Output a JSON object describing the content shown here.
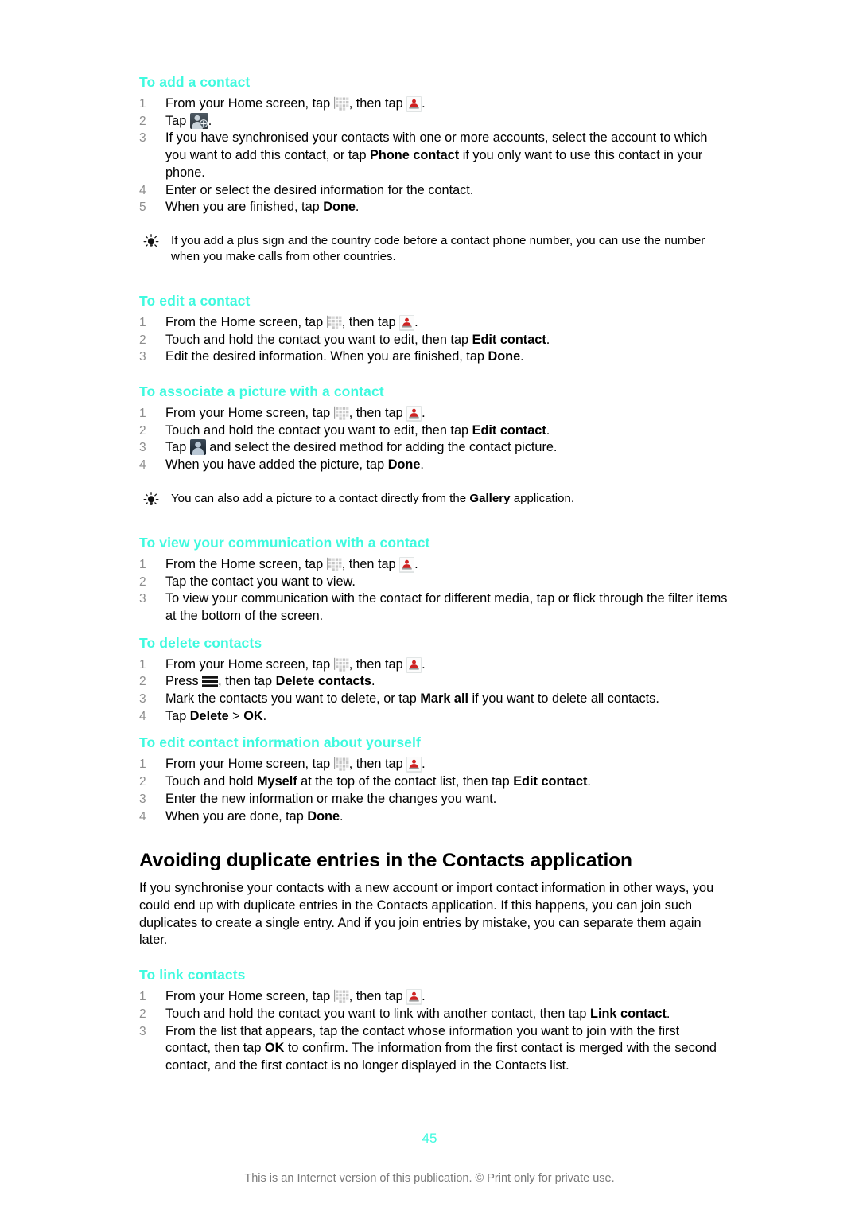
{
  "colors": {
    "heading_accent": "#3ffadf",
    "body_text": "#000000",
    "list_number": "#8d8d8d",
    "footer_text": "#7a7a7a"
  },
  "icons": {
    "app_drawer": "app-drawer-grid-icon",
    "contacts": "contacts-person-icon",
    "add_contact": "add-contact-icon",
    "avatar": "contact-picture-avatar-icon",
    "menu": "hamburger-menu-icon",
    "tip": "light-bulb-tip-icon"
  },
  "sections": [
    {
      "heading": "To add a contact",
      "steps": [
        {
          "num": "1",
          "parts": [
            {
              "t": "text",
              "v": "From your Home screen, tap "
            },
            {
              "t": "icon",
              "v": "app_drawer"
            },
            {
              "t": "text",
              "v": ", then tap "
            },
            {
              "t": "icon",
              "v": "contacts"
            },
            {
              "t": "text",
              "v": "."
            }
          ]
        },
        {
          "num": "2",
          "parts": [
            {
              "t": "text",
              "v": "Tap "
            },
            {
              "t": "icon",
              "v": "add_contact"
            },
            {
              "t": "text",
              "v": "."
            }
          ]
        },
        {
          "num": "3",
          "parts": [
            {
              "t": "text",
              "v": "If you have synchronised your contacts with one or more accounts, select the account to which you want to add this contact, or tap "
            },
            {
              "t": "bold",
              "v": "Phone contact"
            },
            {
              "t": "text",
              "v": " if you only want to use this contact in your phone."
            }
          ]
        },
        {
          "num": "4",
          "parts": [
            {
              "t": "text",
              "v": "Enter or select the desired information for the contact."
            }
          ]
        },
        {
          "num": "5",
          "parts": [
            {
              "t": "text",
              "v": "When you are finished, tap "
            },
            {
              "t": "bold",
              "v": "Done"
            },
            {
              "t": "text",
              "v": "."
            }
          ]
        }
      ]
    },
    {
      "heading": "To edit a contact",
      "steps": [
        {
          "num": "1",
          "parts": [
            {
              "t": "text",
              "v": "From the Home screen, tap "
            },
            {
              "t": "icon",
              "v": "app_drawer"
            },
            {
              "t": "text",
              "v": ", then tap "
            },
            {
              "t": "icon",
              "v": "contacts"
            },
            {
              "t": "text",
              "v": "."
            }
          ]
        },
        {
          "num": "2",
          "parts": [
            {
              "t": "text",
              "v": "Touch and hold the contact you want to edit, then tap "
            },
            {
              "t": "bold",
              "v": "Edit contact"
            },
            {
              "t": "text",
              "v": "."
            }
          ]
        },
        {
          "num": "3",
          "parts": [
            {
              "t": "text",
              "v": "Edit the desired information. When you are finished, tap "
            },
            {
              "t": "bold",
              "v": "Done"
            },
            {
              "t": "text",
              "v": "."
            }
          ]
        }
      ]
    },
    {
      "heading": "To associate a picture with a contact",
      "steps": [
        {
          "num": "1",
          "parts": [
            {
              "t": "text",
              "v": "From your Home screen, tap "
            },
            {
              "t": "icon",
              "v": "app_drawer"
            },
            {
              "t": "text",
              "v": ", then tap "
            },
            {
              "t": "icon",
              "v": "contacts"
            },
            {
              "t": "text",
              "v": "."
            }
          ]
        },
        {
          "num": "2",
          "parts": [
            {
              "t": "text",
              "v": "Touch and hold the contact you want to edit, then tap "
            },
            {
              "t": "bold",
              "v": "Edit contact"
            },
            {
              "t": "text",
              "v": "."
            }
          ]
        },
        {
          "num": "3",
          "parts": [
            {
              "t": "text",
              "v": "Tap "
            },
            {
              "t": "icon",
              "v": "avatar"
            },
            {
              "t": "text",
              "v": " and select the desired method for adding the contact picture."
            }
          ]
        },
        {
          "num": "4",
          "parts": [
            {
              "t": "text",
              "v": "When you have added the picture, tap "
            },
            {
              "t": "bold",
              "v": "Done"
            },
            {
              "t": "text",
              "v": "."
            }
          ]
        }
      ]
    },
    {
      "heading": "To view your communication with a contact",
      "steps": [
        {
          "num": "1",
          "parts": [
            {
              "t": "text",
              "v": "From the Home screen, tap "
            },
            {
              "t": "icon",
              "v": "app_drawer"
            },
            {
              "t": "text",
              "v": ", then tap "
            },
            {
              "t": "icon",
              "v": "contacts"
            },
            {
              "t": "text",
              "v": "."
            }
          ]
        },
        {
          "num": "2",
          "parts": [
            {
              "t": "text",
              "v": "Tap the contact you want to view."
            }
          ]
        },
        {
          "num": "3",
          "parts": [
            {
              "t": "text",
              "v": "To view your communication with the contact for different media, tap or flick through the filter items at the bottom of the screen."
            }
          ]
        }
      ]
    },
    {
      "heading": "To delete contacts",
      "steps": [
        {
          "num": "1",
          "parts": [
            {
              "t": "text",
              "v": "From your Home screen, tap "
            },
            {
              "t": "icon",
              "v": "app_drawer"
            },
            {
              "t": "text",
              "v": ", then tap "
            },
            {
              "t": "icon",
              "v": "contacts"
            },
            {
              "t": "text",
              "v": "."
            }
          ]
        },
        {
          "num": "2",
          "parts": [
            {
              "t": "text",
              "v": "Press "
            },
            {
              "t": "icon",
              "v": "menu"
            },
            {
              "t": "text",
              "v": ", then tap "
            },
            {
              "t": "bold",
              "v": "Delete contacts"
            },
            {
              "t": "text",
              "v": "."
            }
          ]
        },
        {
          "num": "3",
          "parts": [
            {
              "t": "text",
              "v": "Mark the contacts you want to delete, or tap "
            },
            {
              "t": "bold",
              "v": "Mark all"
            },
            {
              "t": "text",
              "v": " if you want to delete all contacts."
            }
          ]
        },
        {
          "num": "4",
          "parts": [
            {
              "t": "text",
              "v": "Tap "
            },
            {
              "t": "bold",
              "v": "Delete"
            },
            {
              "t": "text",
              "v": " > "
            },
            {
              "t": "bold",
              "v": "OK"
            },
            {
              "t": "text",
              "v": "."
            }
          ]
        }
      ]
    },
    {
      "heading": "To edit contact information about yourself",
      "steps": [
        {
          "num": "1",
          "parts": [
            {
              "t": "text",
              "v": "From your Home screen, tap "
            },
            {
              "t": "icon",
              "v": "app_drawer"
            },
            {
              "t": "text",
              "v": ", then tap "
            },
            {
              "t": "icon",
              "v": "contacts"
            },
            {
              "t": "text",
              "v": "."
            }
          ]
        },
        {
          "num": "2",
          "parts": [
            {
              "t": "text",
              "v": "Touch and hold "
            },
            {
              "t": "bold",
              "v": "Myself"
            },
            {
              "t": "text",
              "v": " at the top of the contact list, then tap "
            },
            {
              "t": "bold",
              "v": "Edit contact"
            },
            {
              "t": "text",
              "v": "."
            }
          ]
        },
        {
          "num": "3",
          "parts": [
            {
              "t": "text",
              "v": "Enter the new information or make the changes you want."
            }
          ]
        },
        {
          "num": "4",
          "parts": [
            {
              "t": "text",
              "v": "When you are done, tap "
            },
            {
              "t": "bold",
              "v": "Done"
            },
            {
              "t": "text",
              "v": "."
            }
          ]
        }
      ]
    },
    {
      "heading": "To link contacts",
      "steps": [
        {
          "num": "1",
          "parts": [
            {
              "t": "text",
              "v": "From your Home screen, tap "
            },
            {
              "t": "icon",
              "v": "app_drawer"
            },
            {
              "t": "text",
              "v": ", then tap "
            },
            {
              "t": "icon",
              "v": "contacts"
            },
            {
              "t": "text",
              "v": "."
            }
          ]
        },
        {
          "num": "2",
          "parts": [
            {
              "t": "text",
              "v": "Touch and hold the contact you want to link with another contact, then tap "
            },
            {
              "t": "bold",
              "v": "Link contact"
            },
            {
              "t": "text",
              "v": "."
            }
          ]
        },
        {
          "num": "3",
          "parts": [
            {
              "t": "text",
              "v": "From the list that appears, tap the contact whose information you want to join with the first contact, then tap "
            },
            {
              "t": "bold",
              "v": "OK"
            },
            {
              "t": "text",
              "v": " to confirm. The information from the first contact is merged with the second contact, and the first contact is no longer displayed in the Contacts list."
            }
          ]
        }
      ]
    }
  ],
  "tips": [
    {
      "parts": [
        {
          "t": "text",
          "v": "If you add a plus sign and the country code before a contact phone number, you can use the number when you make calls from other countries."
        }
      ]
    },
    {
      "parts": [
        {
          "t": "text",
          "v": "You can also add a picture to a contact directly from the "
        },
        {
          "t": "bold",
          "v": "Gallery"
        },
        {
          "t": "text",
          "v": " application."
        }
      ]
    }
  ],
  "main_section": {
    "heading": "Avoiding duplicate entries in the Contacts application",
    "paragraph": "If you synchronise your contacts with a new account or import contact information in other ways, you could end up with duplicate entries in the Contacts application. If this happens, you can join such duplicates to create a single entry. And if you join entries by mistake, you can separate them again later."
  },
  "footer": {
    "page_number": "45",
    "note": "This is an Internet version of this publication. © Print only for private use."
  }
}
